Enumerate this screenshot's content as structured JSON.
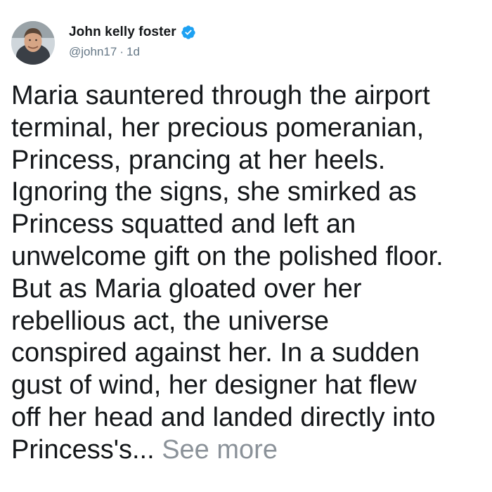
{
  "author": {
    "display_name": "John kelly foster",
    "handle": "@john17",
    "separator": "·",
    "time": "1d",
    "verified": true,
    "verified_icon": "verified-badge-icon",
    "verified_color": "#1da1f2"
  },
  "tweet": {
    "text": "Maria sauntered through the airport\nterminal, her precious pomeranian,\nPrincess, prancing at her heels.\nIgnoring the signs, she smirked as\nPrincess squatted and left an\nunwelcome gift on the polished floor.\nBut as Maria gloated over her\nrebellious act, the universe\nconspired against her. In a sudden\ngust of wind, her designer hat flew\noff her head and landed directly into\nPrincess's... ",
    "see_more_label": "See more",
    "see_more_color": "#8b9299"
  }
}
